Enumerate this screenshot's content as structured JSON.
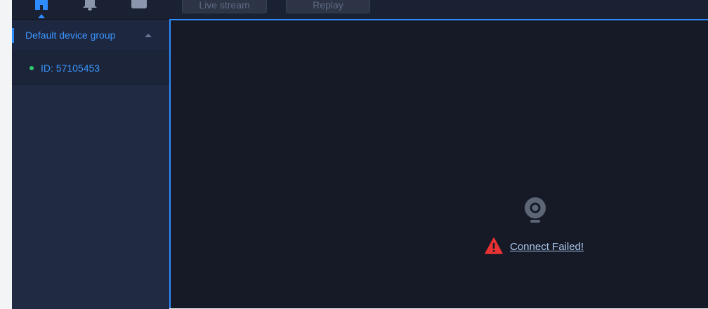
{
  "topbar": {
    "nav_icons": [
      "home-icon",
      "bell-icon",
      "folder-icon"
    ],
    "live_stream_label": "Live stream",
    "replay_label": "Replay"
  },
  "sidebar": {
    "group": {
      "label": "Default device group",
      "expanded": true
    },
    "devices": [
      {
        "label": "ID: 57105453",
        "status": "online"
      }
    ]
  },
  "player": {
    "icon": "webcam-icon",
    "status_icon": "warning-icon",
    "status_text": "Connect Failed!"
  },
  "colors": {
    "accent": "#2f8cff",
    "online": "#2ecc71",
    "warning": "#e63232",
    "background": "#161a26",
    "sidebar": "#202a42"
  }
}
